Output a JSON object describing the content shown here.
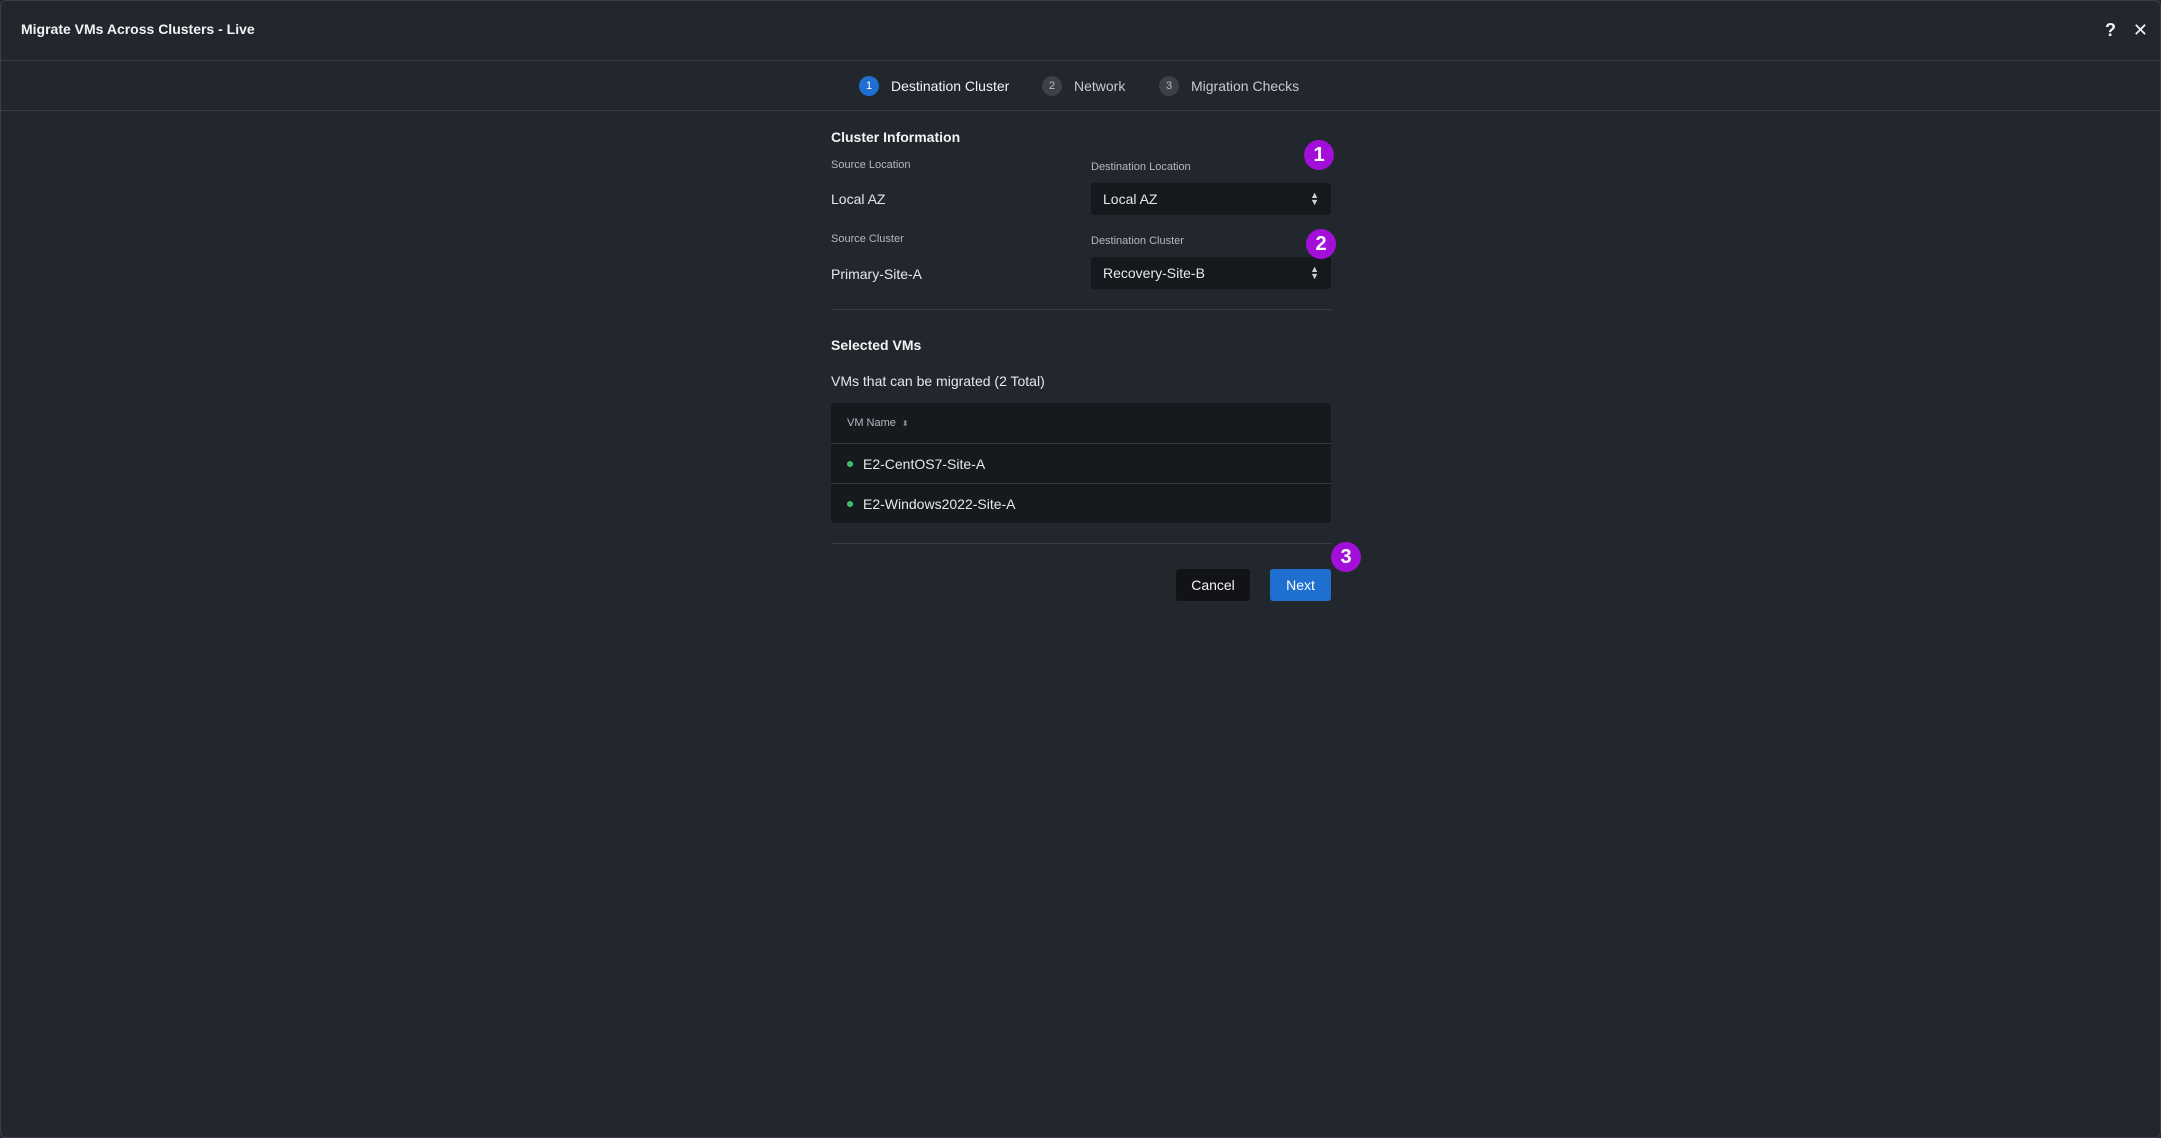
{
  "window": {
    "title": "Migrate VMs Across Clusters - Live",
    "help_icon": "?",
    "close_icon": "✕"
  },
  "stepper": {
    "steps": [
      {
        "num": "1",
        "label": "Destination Cluster",
        "active": true
      },
      {
        "num": "2",
        "label": "Network",
        "active": false
      },
      {
        "num": "3",
        "label": "Migration Checks",
        "active": false
      }
    ]
  },
  "cluster_info": {
    "title": "Cluster Information",
    "source_location_label": "Source Location",
    "source_location_value": "Local AZ",
    "destination_location_label": "Destination Location",
    "destination_location_value": "Local AZ",
    "source_cluster_label": "Source Cluster",
    "source_cluster_value": "Primary-Site-A",
    "destination_cluster_label": "Destination Cluster",
    "destination_cluster_value": "Recovery-Site-B"
  },
  "selected_vms": {
    "title": "Selected VMs",
    "subtitle": "VMs that can be migrated (2 Total)",
    "column_header": "VM Name",
    "rows": [
      {
        "name": "E2-CentOS7-Site-A",
        "status_color": "#3bbf6a"
      },
      {
        "name": "E2-Windows2022-Site-A",
        "status_color": "#3bbf6a"
      }
    ]
  },
  "actions": {
    "cancel_label": "Cancel",
    "next_label": "Next"
  },
  "annotations": {
    "badge_1": "1",
    "badge_2": "2",
    "badge_3": "3",
    "color": "#a10fd8"
  },
  "colors": {
    "accent": "#1f6fd1",
    "background": "#22262d"
  }
}
